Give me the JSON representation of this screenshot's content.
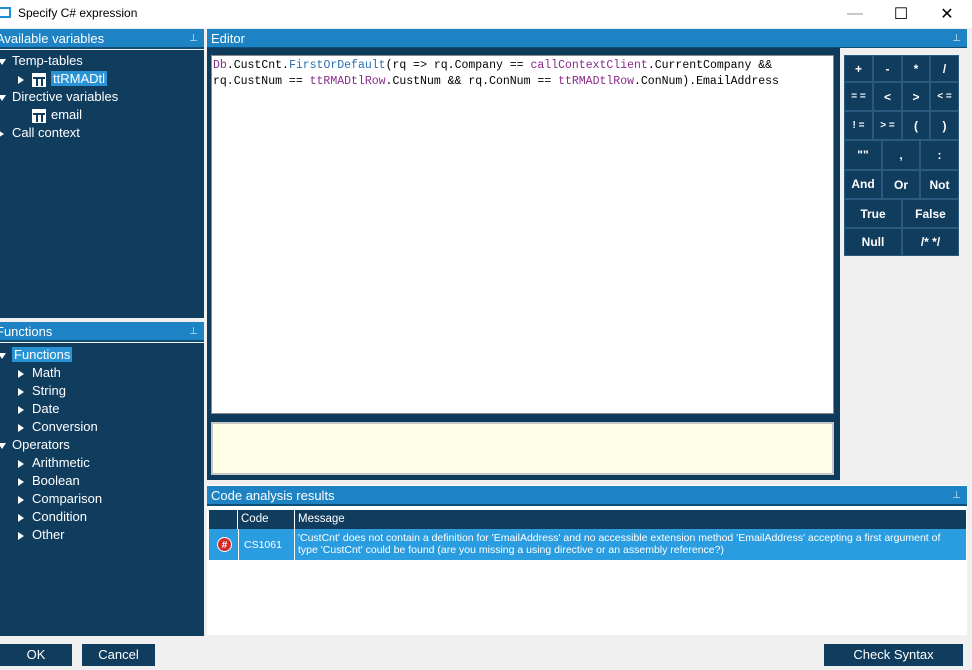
{
  "window": {
    "title": "Specify C# expression",
    "minimize": "—",
    "maximize": "☐",
    "close": "✕"
  },
  "variables_panel": {
    "header": "Available variables",
    "items": [
      {
        "label": "Temp-tables"
      },
      {
        "label": "ttRMADtl"
      },
      {
        "label": "Directive variables"
      },
      {
        "label": "email"
      },
      {
        "label": "Call context"
      }
    ]
  },
  "functions_panel": {
    "header": "Functions",
    "items": [
      {
        "label": "Functions"
      },
      {
        "label": "Math"
      },
      {
        "label": "String"
      },
      {
        "label": "Date"
      },
      {
        "label": "Conversion"
      },
      {
        "label": "Operators"
      },
      {
        "label": "Arithmetic"
      },
      {
        "label": "Boolean"
      },
      {
        "label": "Comparison"
      },
      {
        "label": "Condition"
      },
      {
        "label": "Other"
      }
    ]
  },
  "editor": {
    "header": "Editor",
    "line1": {
      "a": "Db",
      "b": ".CustCnt.",
      "c": "FirstOrDefault",
      "d": "(rq => rq.Company == ",
      "e": "callContextClient",
      "f": ".CurrentCompany &&"
    },
    "line2": {
      "a": "rq.CustNum == ",
      "b": "ttRMADtlRow",
      "c": ".CustNum && rq.ConNum == ",
      "d": "ttRMADtlRow",
      "e": ".ConNum).EmailAddress"
    }
  },
  "keypad": {
    "plus": "+",
    "minus": "-",
    "times": "*",
    "divide": "/",
    "eq": "= =",
    "lt": "<",
    "gt": ">",
    "le": "< =",
    "ne": "! =",
    "ge": "> =",
    "open": "(",
    "close": ")",
    "quote": "\"\"",
    "comma": ",",
    "colon": ":",
    "and": "And",
    "or": "Or",
    "not": "Not",
    "true": "True",
    "false": "False",
    "null": "Null",
    "comment": "/* */"
  },
  "results": {
    "header": "Code analysis results",
    "columns": {
      "code": "Code",
      "message": "Message"
    },
    "rows": [
      {
        "code": "CS1061",
        "message": "'CustCnt' does not contain a definition for 'EmailAddress' and no accessible extension method 'EmailAddress' accepting a first argument of type 'CustCnt' could be found (are you missing a using directive or an assembly reference?)"
      }
    ]
  },
  "buttons": {
    "ok": "OK",
    "cancel": "Cancel",
    "check_syntax": "Check Syntax"
  },
  "colors": {
    "panel": "#103c5e",
    "header": "#1e83c4",
    "selected": "#2a9de0"
  }
}
